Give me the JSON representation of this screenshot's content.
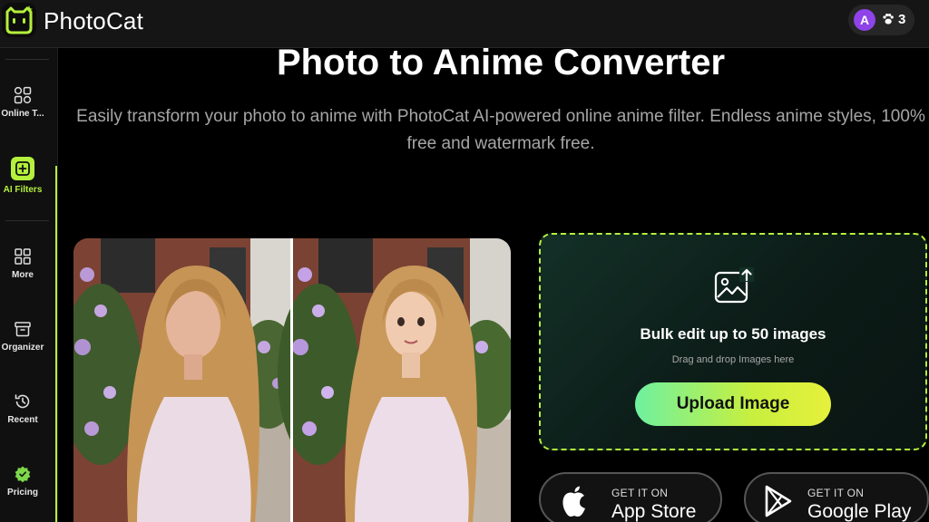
{
  "app": {
    "name": "PhotoCat"
  },
  "account": {
    "avatar_letter": "A",
    "credits": "3"
  },
  "sidebar": {
    "items": [
      {
        "label": "Online T...",
        "icon": "apps-icon"
      },
      {
        "label": "AI Filters",
        "icon": "ai-filter-icon",
        "active": true
      },
      {
        "label": "More",
        "icon": "grid-icon"
      },
      {
        "label": "Organizer",
        "icon": "archive-icon"
      },
      {
        "label": "Recent",
        "icon": "history-icon"
      },
      {
        "label": "Pricing",
        "icon": "pricing-badge-icon"
      }
    ]
  },
  "main": {
    "title": "Photo to Anime Converter",
    "subtitle": "Easily transform your photo to anime with PhotoCat AI-powered online anime filter. Endless anime styles, 100% free and watermark free."
  },
  "upload": {
    "heading": "Bulk edit up to 50 images",
    "hint": "Drag and drop Images here",
    "button_label": "Upload Image"
  },
  "stores": {
    "appstore": {
      "small": "GET IT ON",
      "big": "App Store"
    },
    "gplay": {
      "small": "GET IT ON",
      "big": "Google Play"
    }
  },
  "colors": {
    "accent": "#b4f03c",
    "background": "#000000",
    "topbar": "#151515"
  }
}
